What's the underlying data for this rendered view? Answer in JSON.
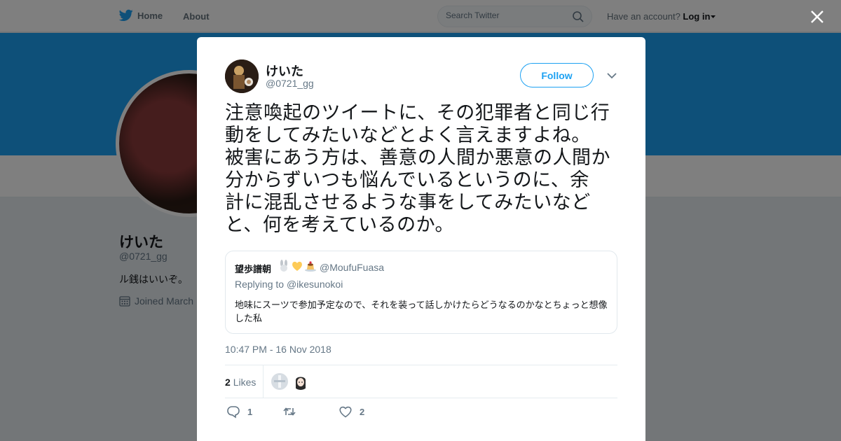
{
  "topbar": {
    "home_label": "Home",
    "about_label": "About",
    "search_placeholder": "Search Twitter",
    "account_prompt": "Have an account?",
    "login_label": "Log in"
  },
  "profile": {
    "name": "けいた",
    "handle": "@0721_gg",
    "bio": "ル銭はいいぞ。",
    "joined": "Joined March"
  },
  "tweet": {
    "author_name": "けいた",
    "author_handle": "@0721_gg",
    "follow_label": "Follow",
    "text": "注意喚起のツイートに、その犯罪者と同じ行\n動をしてみたいなどとよく言えますよね。\n被害にあう方は、善意の人間か悪意の人間か\n分からずいつも悩んでいるというのに、余\n計に混乱させるような事をしてみたいなど\nと、何を考えているのか。",
    "quote": {
      "name": "望歩譜朝",
      "handle": "@MoufuFuasa",
      "replying_prefix": "Replying to",
      "replying_to": "@ikesunokoi",
      "text": "地味にスーツで参加予定なので、それを装って話しかけたらどうなるのかなとちょっと想像した私"
    },
    "timestamp": "10:47 PM - 16 Nov 2018",
    "likes_count": "2",
    "likes_label": "Likes",
    "reply_count": "1",
    "retweet_count": "",
    "like_count": "2"
  }
}
